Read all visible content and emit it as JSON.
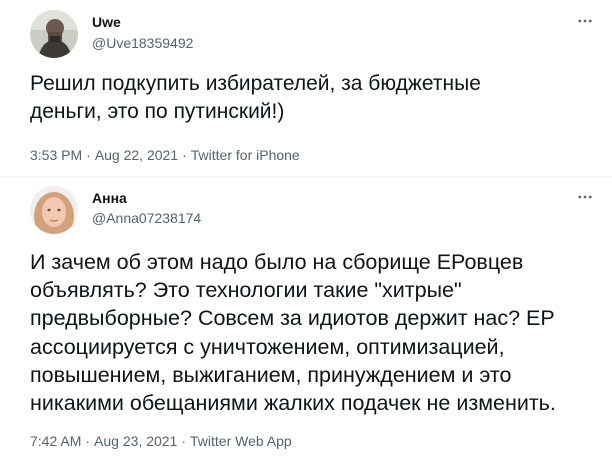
{
  "tweets": [
    {
      "name": "Uwe",
      "handle": "@Uve18359492",
      "text": "Решил подкупить избирателей, за бюджетные\nденьги, это по путинский!)",
      "time": "3:53 PM",
      "date": "Aug 22, 2021",
      "source": "Twitter for iPhone"
    },
    {
      "name": "Анна",
      "handle": "@Anna07238174",
      "text": "И зачем об этом надо было на сборище ЕРовцев\nобъявлять? Это технологии такие \"хитрые\"\nпредвыборные? Совсем за идиотов держит нас? ЕР\nассоциируется с уничтожением, оптимизацией,\nповышением, выжиганием, принуждением и это\nникакими обещаниями жалких подачек не изменить.",
      "time": "7:42 AM",
      "date": "Aug 23, 2021",
      "source": "Twitter Web App"
    }
  ],
  "separator": "·",
  "icons": {
    "more": "more-horizontal-icon"
  },
  "colors": {
    "text": "#0f1419",
    "secondary": "#536471",
    "divider": "#eff3f4"
  }
}
